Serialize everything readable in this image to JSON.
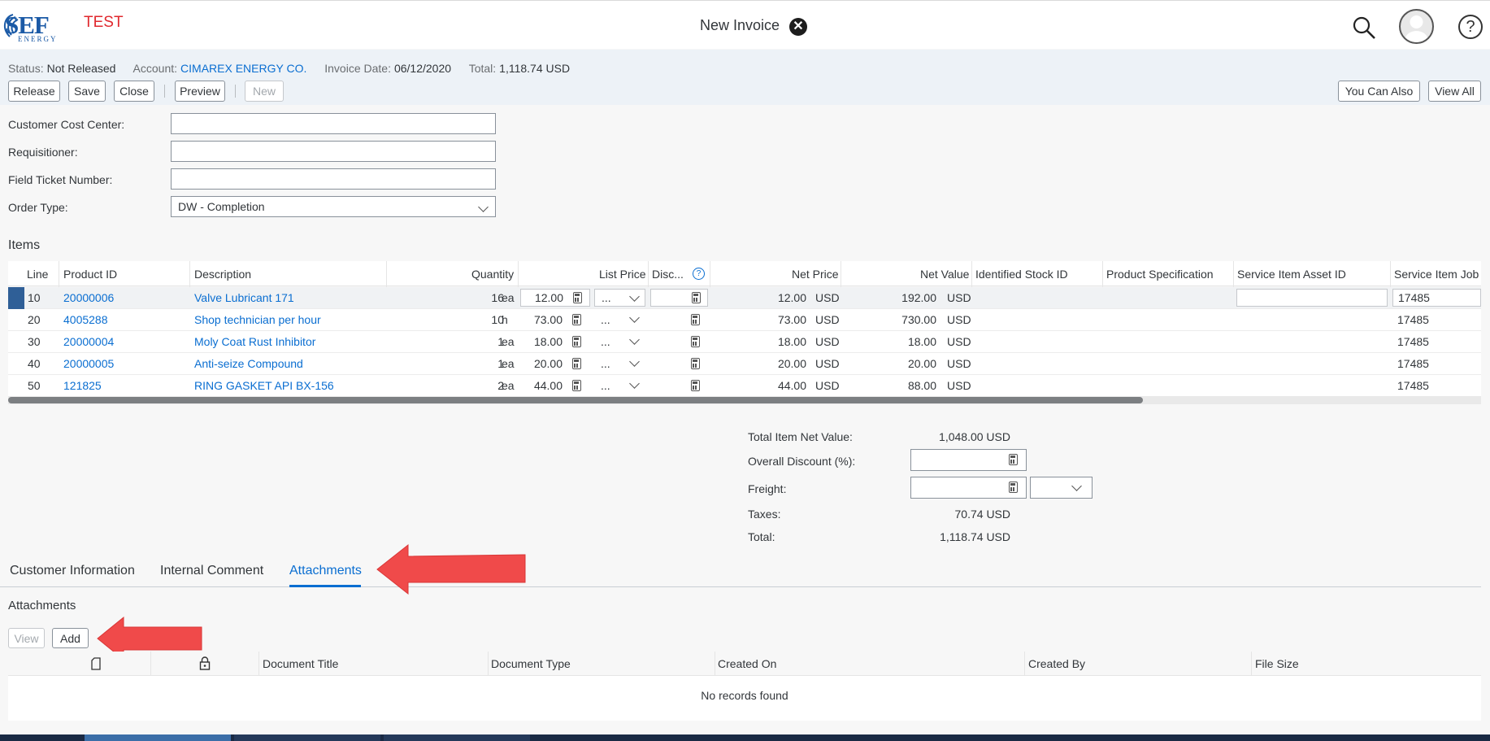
{
  "shell": {
    "logo_text": "SEF",
    "logo_sub": "ENERGY",
    "env": "TEST",
    "title": "New Invoice"
  },
  "header": {
    "status_label": "Status:",
    "status_value": "Not Released",
    "account_label": "Account:",
    "account_value": "CIMAREX ENERGY CO.",
    "date_label": "Invoice Date:",
    "date_value": "06/12/2020",
    "total_label": "Total:",
    "total_value": "1,118.74 USD",
    "buttons": {
      "release": "Release",
      "save": "Save",
      "close": "Close",
      "preview": "Preview",
      "new": "New",
      "you_can_also": "You Can Also",
      "view_all": "View All"
    }
  },
  "form": {
    "cost_center_label": "Customer Cost Center:",
    "cost_center_value": "",
    "requisitioner_label": "Requisitioner:",
    "requisitioner_value": "",
    "field_ticket_label": "Field Ticket Number:",
    "field_ticket_value": "",
    "order_type_label": "Order Type:",
    "order_type_value": "DW - Completion"
  },
  "items": {
    "title": "Items",
    "columns": {
      "line": "Line",
      "product_id": "Product ID",
      "description": "Description",
      "quantity": "Quantity",
      "list_price": "List Price",
      "discount": "Disc...",
      "net_price": "Net Price",
      "net_value": "Net Value",
      "identified_stock": "Identified Stock ID",
      "product_spec": "Product Specification",
      "asset_id": "Service Item Asset ID",
      "service_job": "Service Item Job"
    },
    "rows": [
      {
        "line": "10",
        "product_id": "20000006",
        "description": "Valve Lubricant 171",
        "qty": "16",
        "uom": "ea",
        "price": "12.00",
        "ellipsis": "...",
        "net_price": "12.00",
        "cur1": "USD",
        "net_value": "192.00",
        "cur2": "USD",
        "job": "17485"
      },
      {
        "line": "20",
        "product_id": "4005288",
        "description": "Shop technician per hour",
        "qty": "10",
        "uom": "h",
        "price": "73.00",
        "ellipsis": "...",
        "net_price": "73.00",
        "cur1": "USD",
        "net_value": "730.00",
        "cur2": "USD",
        "job": "17485"
      },
      {
        "line": "30",
        "product_id": "20000004",
        "description": "Moly Coat Rust Inhibitor",
        "qty": "1",
        "uom": "ea",
        "price": "18.00",
        "ellipsis": "...",
        "net_price": "18.00",
        "cur1": "USD",
        "net_value": "18.00",
        "cur2": "USD",
        "job": "17485"
      },
      {
        "line": "40",
        "product_id": "20000005",
        "description": "Anti-seize Compound",
        "qty": "1",
        "uom": "ea",
        "price": "20.00",
        "ellipsis": "...",
        "net_price": "20.00",
        "cur1": "USD",
        "net_value": "20.00",
        "cur2": "USD",
        "job": "17485"
      },
      {
        "line": "50",
        "product_id": "121825",
        "description": "RING GASKET API BX-156",
        "qty": "2",
        "uom": "ea",
        "price": "44.00",
        "ellipsis": "...",
        "net_price": "44.00",
        "cur1": "USD",
        "net_value": "88.00",
        "cur2": "USD",
        "job": "17485"
      }
    ]
  },
  "totals": {
    "net_value_label": "Total Item Net Value:",
    "net_value": "1,048.00 USD",
    "discount_label": "Overall Discount (%):",
    "freight_label": "Freight:",
    "taxes_label": "Taxes:",
    "taxes": "70.74 USD",
    "total_label": "Total:",
    "total": "1,118.74 USD"
  },
  "tabs": {
    "customer_info": "Customer Information",
    "internal_comment": "Internal Comment",
    "attachments": "Attachments"
  },
  "attachments": {
    "title": "Attachments",
    "view_button": "View",
    "add_button": "Add",
    "columns": {
      "title": "Document Title",
      "type": "Document Type",
      "created_on": "Created On",
      "created_by": "Created By",
      "size": "File Size"
    },
    "empty": "No records found"
  },
  "colors": {
    "accent": "#0a6ed1",
    "env_red": "#e0282e",
    "arrow_red": "#f04a4a",
    "header_bg": "#edf2f7"
  }
}
